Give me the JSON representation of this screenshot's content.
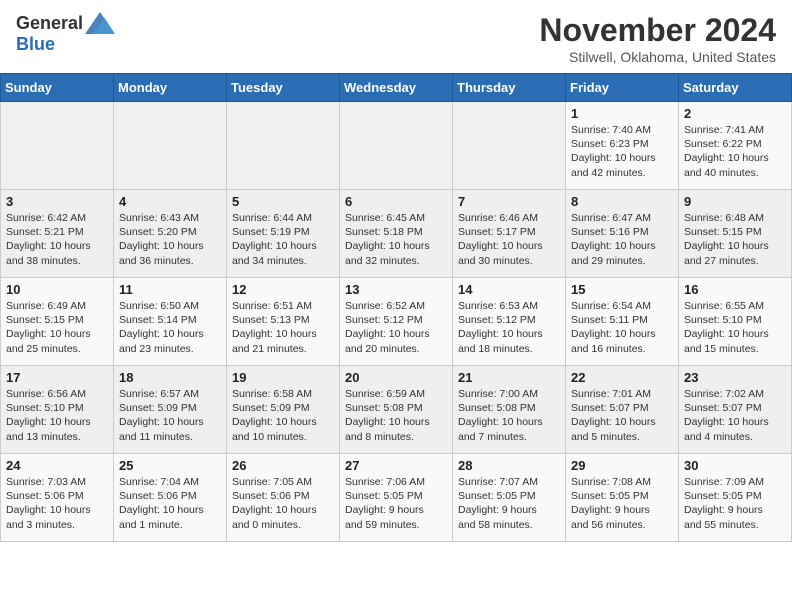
{
  "header": {
    "logo_general": "General",
    "logo_blue": "Blue",
    "month_title": "November 2024",
    "location": "Stilwell, Oklahoma, United States"
  },
  "days_of_week": [
    "Sunday",
    "Monday",
    "Tuesday",
    "Wednesday",
    "Thursday",
    "Friday",
    "Saturday"
  ],
  "weeks": [
    [
      {
        "day": "",
        "info": ""
      },
      {
        "day": "",
        "info": ""
      },
      {
        "day": "",
        "info": ""
      },
      {
        "day": "",
        "info": ""
      },
      {
        "day": "",
        "info": ""
      },
      {
        "day": "1",
        "info": "Sunrise: 7:40 AM\nSunset: 6:23 PM\nDaylight: 10 hours\nand 42 minutes."
      },
      {
        "day": "2",
        "info": "Sunrise: 7:41 AM\nSunset: 6:22 PM\nDaylight: 10 hours\nand 40 minutes."
      }
    ],
    [
      {
        "day": "3",
        "info": "Sunrise: 6:42 AM\nSunset: 5:21 PM\nDaylight: 10 hours\nand 38 minutes."
      },
      {
        "day": "4",
        "info": "Sunrise: 6:43 AM\nSunset: 5:20 PM\nDaylight: 10 hours\nand 36 minutes."
      },
      {
        "day": "5",
        "info": "Sunrise: 6:44 AM\nSunset: 5:19 PM\nDaylight: 10 hours\nand 34 minutes."
      },
      {
        "day": "6",
        "info": "Sunrise: 6:45 AM\nSunset: 5:18 PM\nDaylight: 10 hours\nand 32 minutes."
      },
      {
        "day": "7",
        "info": "Sunrise: 6:46 AM\nSunset: 5:17 PM\nDaylight: 10 hours\nand 30 minutes."
      },
      {
        "day": "8",
        "info": "Sunrise: 6:47 AM\nSunset: 5:16 PM\nDaylight: 10 hours\nand 29 minutes."
      },
      {
        "day": "9",
        "info": "Sunrise: 6:48 AM\nSunset: 5:15 PM\nDaylight: 10 hours\nand 27 minutes."
      }
    ],
    [
      {
        "day": "10",
        "info": "Sunrise: 6:49 AM\nSunset: 5:15 PM\nDaylight: 10 hours\nand 25 minutes."
      },
      {
        "day": "11",
        "info": "Sunrise: 6:50 AM\nSunset: 5:14 PM\nDaylight: 10 hours\nand 23 minutes."
      },
      {
        "day": "12",
        "info": "Sunrise: 6:51 AM\nSunset: 5:13 PM\nDaylight: 10 hours\nand 21 minutes."
      },
      {
        "day": "13",
        "info": "Sunrise: 6:52 AM\nSunset: 5:12 PM\nDaylight: 10 hours\nand 20 minutes."
      },
      {
        "day": "14",
        "info": "Sunrise: 6:53 AM\nSunset: 5:12 PM\nDaylight: 10 hours\nand 18 minutes."
      },
      {
        "day": "15",
        "info": "Sunrise: 6:54 AM\nSunset: 5:11 PM\nDaylight: 10 hours\nand 16 minutes."
      },
      {
        "day": "16",
        "info": "Sunrise: 6:55 AM\nSunset: 5:10 PM\nDaylight: 10 hours\nand 15 minutes."
      }
    ],
    [
      {
        "day": "17",
        "info": "Sunrise: 6:56 AM\nSunset: 5:10 PM\nDaylight: 10 hours\nand 13 minutes."
      },
      {
        "day": "18",
        "info": "Sunrise: 6:57 AM\nSunset: 5:09 PM\nDaylight: 10 hours\nand 11 minutes."
      },
      {
        "day": "19",
        "info": "Sunrise: 6:58 AM\nSunset: 5:09 PM\nDaylight: 10 hours\nand 10 minutes."
      },
      {
        "day": "20",
        "info": "Sunrise: 6:59 AM\nSunset: 5:08 PM\nDaylight: 10 hours\nand 8 minutes."
      },
      {
        "day": "21",
        "info": "Sunrise: 7:00 AM\nSunset: 5:08 PM\nDaylight: 10 hours\nand 7 minutes."
      },
      {
        "day": "22",
        "info": "Sunrise: 7:01 AM\nSunset: 5:07 PM\nDaylight: 10 hours\nand 5 minutes."
      },
      {
        "day": "23",
        "info": "Sunrise: 7:02 AM\nSunset: 5:07 PM\nDaylight: 10 hours\nand 4 minutes."
      }
    ],
    [
      {
        "day": "24",
        "info": "Sunrise: 7:03 AM\nSunset: 5:06 PM\nDaylight: 10 hours\nand 3 minutes."
      },
      {
        "day": "25",
        "info": "Sunrise: 7:04 AM\nSunset: 5:06 PM\nDaylight: 10 hours\nand 1 minute."
      },
      {
        "day": "26",
        "info": "Sunrise: 7:05 AM\nSunset: 5:06 PM\nDaylight: 10 hours\nand 0 minutes."
      },
      {
        "day": "27",
        "info": "Sunrise: 7:06 AM\nSunset: 5:05 PM\nDaylight: 9 hours\nand 59 minutes."
      },
      {
        "day": "28",
        "info": "Sunrise: 7:07 AM\nSunset: 5:05 PM\nDaylight: 9 hours\nand 58 minutes."
      },
      {
        "day": "29",
        "info": "Sunrise: 7:08 AM\nSunset: 5:05 PM\nDaylight: 9 hours\nand 56 minutes."
      },
      {
        "day": "30",
        "info": "Sunrise: 7:09 AM\nSunset: 5:05 PM\nDaylight: 9 hours\nand 55 minutes."
      }
    ]
  ]
}
